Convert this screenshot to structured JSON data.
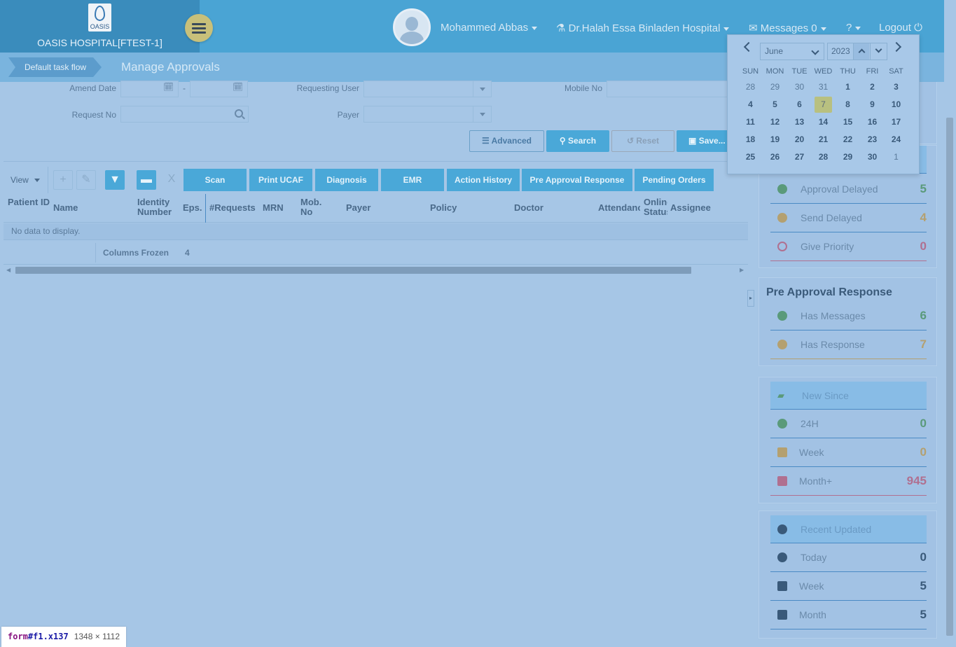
{
  "header": {
    "brand_name": "OASIS HOSPITAL[FTEST-1]",
    "logo_text": "OASIS",
    "user_name": "Mohammed Abbas",
    "hospital": "Dr.Halah Essa Binladen Hospital",
    "messages": "Messages 0",
    "logout": "Logout"
  },
  "breadcrumb": {
    "task_flow": "Default task flow",
    "page_title": "Manage Approvals"
  },
  "form": {
    "amend_date_label": "Amend Date",
    "date_separator": "-",
    "requesting_user_label": "Requesting User",
    "mobile_no_label": "Mobile No",
    "request_no_label": "Request No",
    "payer_label": "Payer",
    "advanced": "Advanced",
    "search": "Search",
    "reset": "Reset",
    "save": "Save..."
  },
  "toolbar": {
    "view": "View",
    "buttons": [
      "Scan",
      "Print UCAF",
      "Diagnosis",
      "EMR",
      "Action History",
      "Pre Approval Response",
      "Pending Orders"
    ]
  },
  "table": {
    "columns": [
      "Patient ID",
      "Name",
      "Identity Number",
      "Eps.",
      "#Requests",
      "MRN",
      "Mob. No",
      "Payer",
      "Policy",
      "Doctor",
      "Attendance",
      "Online Status",
      "Assignee"
    ],
    "empty_text": "No data to display.",
    "frozen_label": "Columns Frozen",
    "frozen_count": "4"
  },
  "stats": {
    "delayed": [
      {
        "label": "Approval Delayed",
        "value": "5",
        "color": "#5a9a7a"
      },
      {
        "label": "Send Delayed",
        "value": "4",
        "color": "#b4a070"
      },
      {
        "label": "Give Priority",
        "value": "0",
        "color": "#b07090"
      }
    ],
    "pre_approval": {
      "title": "Pre Approval Response",
      "rows": [
        {
          "label": "Has Messages",
          "value": "6",
          "color": "#5a9a7a"
        },
        {
          "label": "Has Response",
          "value": "7",
          "color": "#b4a070"
        }
      ]
    },
    "new_since": {
      "title": "New Since",
      "rows": [
        {
          "label": "24H",
          "value": "0",
          "color": "#5a9a7a"
        },
        {
          "label": "Week",
          "value": "0",
          "color": "#b4a070"
        },
        {
          "label": "Month+",
          "value": "945",
          "color": "#b07090"
        }
      ]
    },
    "recent_updated": {
      "title": "Recent Updated",
      "rows": [
        {
          "label": "Today",
          "value": "0",
          "color": "#3a5a7a"
        },
        {
          "label": "Week",
          "value": "5",
          "color": "#3a5a7a"
        },
        {
          "label": "Month",
          "value": "5",
          "color": "#3a5a7a"
        }
      ]
    }
  },
  "calendar": {
    "month": "June",
    "year": "2023",
    "dow": [
      "SUN",
      "MON",
      "TUE",
      "WED",
      "THU",
      "FRI",
      "SAT"
    ],
    "weeks": [
      [
        "28",
        "29",
        "30",
        "31",
        "1",
        "2",
        "3"
      ],
      [
        "4",
        "5",
        "6",
        "7",
        "8",
        "9",
        "10"
      ],
      [
        "11",
        "12",
        "13",
        "14",
        "15",
        "16",
        "17"
      ],
      [
        "18",
        "19",
        "20",
        "21",
        "22",
        "23",
        "24"
      ],
      [
        "25",
        "26",
        "27",
        "28",
        "29",
        "30",
        "1"
      ]
    ],
    "selected": "7"
  },
  "inspector": {
    "selector": "form",
    "id": "#f1.x137",
    "dims": "1348 × 1112"
  }
}
